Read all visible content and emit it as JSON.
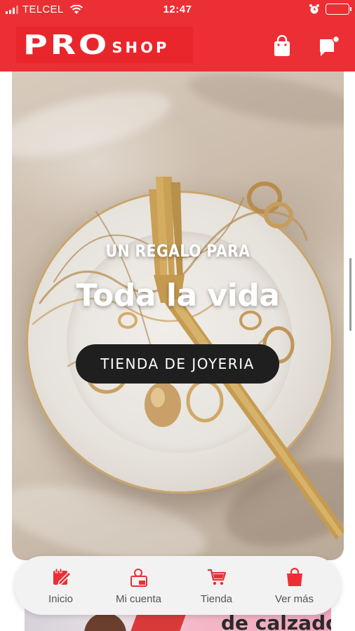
{
  "status_bar": {
    "carrier": "TELCEL",
    "time": "12:47"
  },
  "header": {
    "logo_primary": "PRO",
    "logo_secondary": "SHOP",
    "icons": [
      "shopping-bag-icon",
      "chat-notification-icon"
    ]
  },
  "hero": {
    "kicker": "UN REGALO PARA",
    "title": "Toda la vida",
    "cta_label": "TIENDA DE JOYERIA"
  },
  "banner_peek": {
    "text": "de calzado"
  },
  "tab_bar": {
    "items": [
      {
        "label": "Inicio",
        "icon": "home-notepad-icon"
      },
      {
        "label": "Mi cuenta",
        "icon": "account-icon"
      },
      {
        "label": "Tienda",
        "icon": "cart-icon"
      },
      {
        "label": "Ver más",
        "icon": "bag-icon"
      }
    ]
  },
  "colors": {
    "brand_red": "#ec2f35",
    "cta_background": "#1f1f1f",
    "tab_bar_background": "#f2f2f2"
  }
}
